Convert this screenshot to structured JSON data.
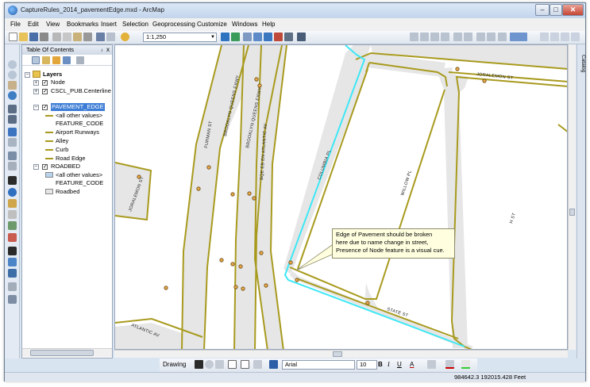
{
  "window": {
    "title": "CaptureRules_2014_pavementEdge.mxd - ArcMap"
  },
  "menu": [
    "File",
    "Edit",
    "View",
    "Bookmarks",
    "Insert",
    "Selection",
    "Geoprocessing",
    "Customize",
    "Windows",
    "Help"
  ],
  "toolbar": {
    "scale": "1:1,250"
  },
  "toc": {
    "title": "Table Of Contents",
    "pin": "ⱼ",
    "close": "x",
    "root": "Layers",
    "layers": {
      "node": "Node",
      "centerline": "CSCL_PUB.Centerline",
      "pavement_edge": "PAVEMENT_EDGE",
      "pe_all_other": "<all other values>",
      "pe_field": "FEATURE_CODE",
      "pe_airport": "Airport Runways",
      "pe_alley": "Alley",
      "pe_curb": "Curb",
      "pe_road_edge": "Road Edge",
      "roadbed": "ROADBED",
      "rb_all_other": "<all other values>",
      "rb_field": "FEATURE_CODE",
      "rb_roadbed": "Roadbed"
    }
  },
  "map": {
    "streets": {
      "joralemon_right": "JORALEMON ST",
      "brooklyn_queens_1": "BROOKLYN QUEENS EXWY",
      "brooklyn_queens_2": "BROOKLYN QUEENS EXWY",
      "bqe_atlantic": "BQE EB EN ATLANTIC AV",
      "furman": "FURMAN ST",
      "columbia": "COLUMBIA PL",
      "willow": "WILLOW PL",
      "hicks": "H    ST",
      "joralemon_left": "JORALEMON ST",
      "state": "STATE ST",
      "atlantic": "ATLANTIC AV"
    },
    "callout": [
      "Edge of Pavement should be broken",
      "here due to name change in street,",
      "Presence of Node feature is a visual cue."
    ],
    "colors": {
      "road_fill": "#e6e6e6",
      "road_edge": "#a89a1e",
      "highlight": "#3ee8f5",
      "node": "#e8a84a"
    }
  },
  "catalog": "Catalog",
  "drawing": {
    "label": "Drawing",
    "font": "Arial",
    "size": "10",
    "bold": "B",
    "italic": "I",
    "underline": "U",
    "font_color": "A"
  },
  "status": {
    "coordinates": "984642.3  192015.428 Feet"
  }
}
